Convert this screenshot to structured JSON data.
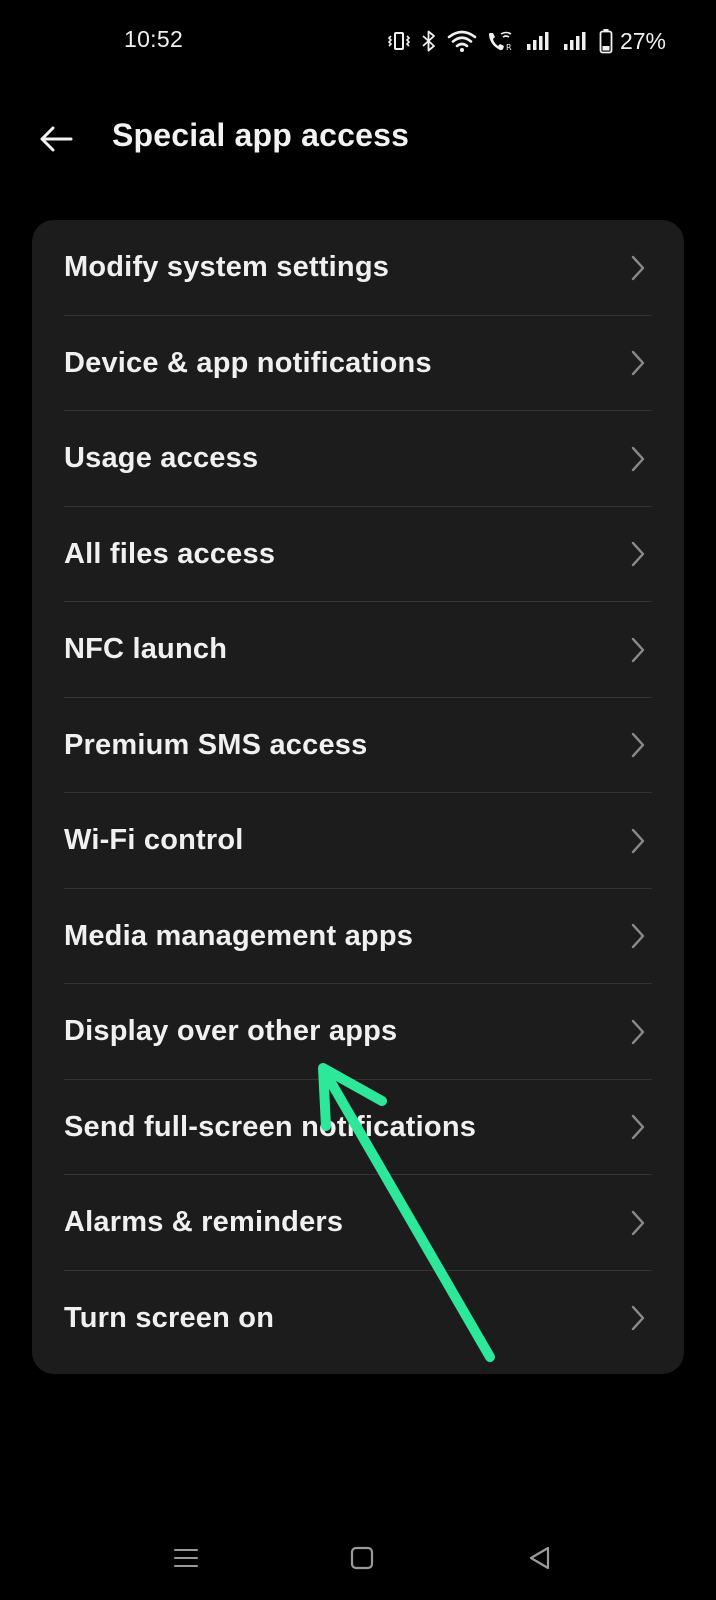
{
  "status_bar": {
    "time": "10:52",
    "battery_percent": "27%",
    "icons": [
      "vibrate-icon",
      "bluetooth-icon",
      "wifi-icon",
      "wifi-calling-icon",
      "signal-icon",
      "signal-icon",
      "battery-icon"
    ]
  },
  "header": {
    "title": "Special app access",
    "back_icon": "arrow-left-icon"
  },
  "menu": {
    "items": [
      {
        "label": "Modify system settings"
      },
      {
        "label": "Device & app notifications"
      },
      {
        "label": "Usage access"
      },
      {
        "label": "All files access"
      },
      {
        "label": "NFC launch"
      },
      {
        "label": "Premium SMS access"
      },
      {
        "label": "Wi-Fi control"
      },
      {
        "label": "Media management apps"
      },
      {
        "label": "Display over other apps"
      },
      {
        "label": "Send full-screen notifications"
      },
      {
        "label": "Alarms & reminders"
      },
      {
        "label": "Turn screen on"
      }
    ]
  },
  "annotation": {
    "color": "#2ee89a",
    "points_to": "Display over other apps"
  },
  "nav_bar": {
    "icons": [
      "menu-icon",
      "home-icon",
      "back-icon"
    ]
  },
  "colors": {
    "background": "#000000",
    "card": "#1c1c1c",
    "text": "#f0f0f0",
    "chevron": "#8a8a8a",
    "accent": "#2ee89a"
  }
}
